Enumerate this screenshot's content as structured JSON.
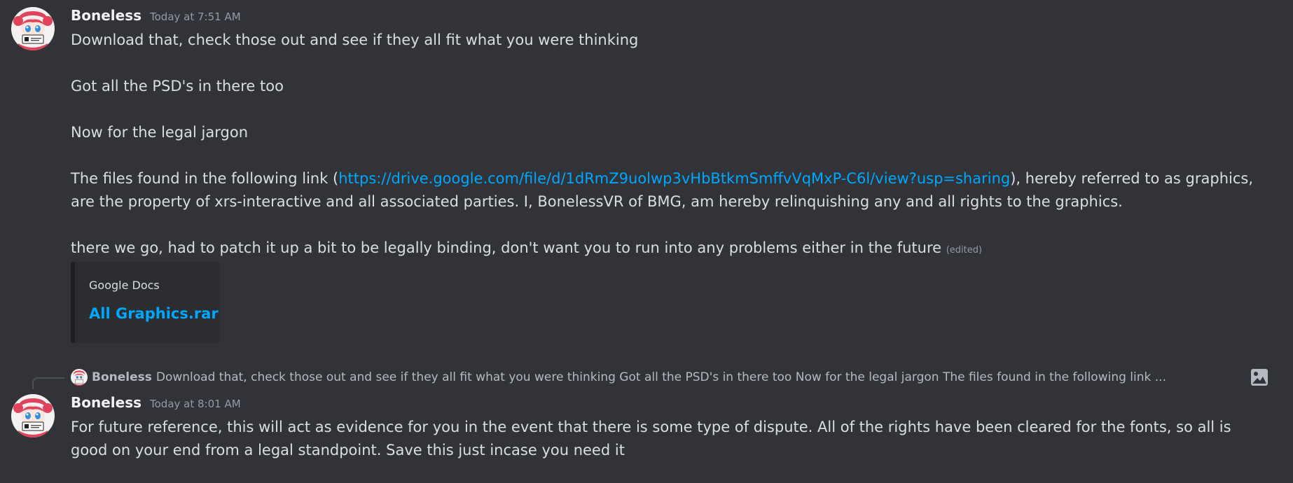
{
  "message1": {
    "username": "Boneless",
    "timestamp": "Today at 7:51 AM",
    "line1": "Download that, check those out and see if they all fit what you were thinking",
    "line2": "Got all the PSD's in there too",
    "line3": "Now for the legal jargon",
    "legal_prefix": "The files found in the following link (",
    "legal_link": "https://drive.google.com/file/d/1dRmZ9uolwp3vHbBtkmSmffvVqMxP-C6l/view?usp=sharing",
    "legal_suffix": "), hereby referred to as graphics, are the property of xrs-interactive and all associated parties. I, BonelessVR of BMG, am hereby relinquishing any and all rights to the graphics.",
    "line5": "there we go, had to patch it up a bit to be legally binding, don't want you to run into any problems either in the future",
    "edited": "(edited)",
    "embed": {
      "provider": "Google Docs",
      "title": "All Graphics.rar"
    }
  },
  "reply": {
    "username": "Boneless",
    "preview": "Download that, check those out and see if they all fit what you were thinking  Got all the PSD's in there too  Now for the legal jargon  The files found in the following link ...",
    "attachment_icon": "image-icon"
  },
  "message2": {
    "username": "Boneless",
    "timestamp": "Today at 8:01 AM",
    "text": "For future reference, this will act as evidence for you in the event that there is some type of dispute. All of the rights have been cleared for the fonts, so all is good on your end from a legal standpoint. Save this just incase you need it"
  },
  "colors": {
    "background": "#313338",
    "link": "#00a8fc",
    "username": "#f2f3f5",
    "muted": "#949ba4"
  }
}
